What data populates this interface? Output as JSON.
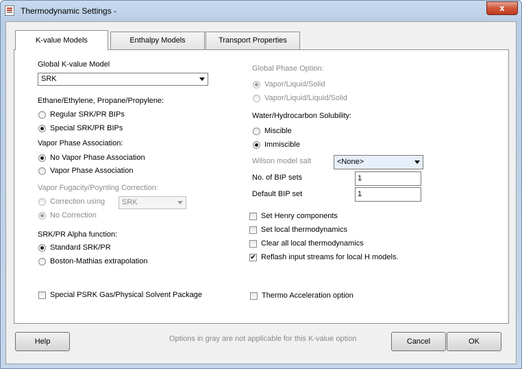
{
  "window": {
    "title": "Thermodynamic Settings -",
    "close": "x"
  },
  "tabs": [
    {
      "label": "K-value Models",
      "active": true
    },
    {
      "label": "Enthalpy Models",
      "active": false
    },
    {
      "label": "Transport Properties",
      "active": false
    }
  ],
  "left": {
    "global_k_label": "Global K-value Model",
    "global_k_value": "SRK",
    "ethane_label": "Ethane/Ethylene, Propane/Propylene:",
    "ethane_options": [
      "Regular SRK/PR BIPs",
      "Special SRK/PR BIPs"
    ],
    "vpa_label": "Vapor Phase Association:",
    "vpa_options": [
      "No Vapor Phase Association",
      "Vapor Phase Association"
    ],
    "fugacity_label": "Vapor Fugacity/Poynting Correction:",
    "fugacity_options": [
      "Correction using",
      "No Correction"
    ],
    "fugacity_select": "SRK",
    "alpha_label": "SRK/PR Alpha function:",
    "alpha_options": [
      "Standard SRK/PR",
      "Boston-Mathias extrapolation"
    ],
    "psrk_label": "Special PSRK Gas/Physical Solvent Package"
  },
  "right": {
    "global_phase_label": "Global Phase Option:",
    "phase_options": [
      "Vapor/Liquid/Solid",
      "Vapor/Liquid/Liquid/Solid"
    ],
    "water_label": "Water/Hydrocarbon Solubility:",
    "water_options": [
      "Miscible",
      "Immiscible"
    ],
    "wilson_label": "Wilson model salt",
    "wilson_value": "<None>",
    "bip_sets_label": "No. of BIP sets",
    "bip_sets_value": "1",
    "default_bip_label": "Default BIP set",
    "default_bip_value": "1",
    "checks": [
      {
        "label": "Set Henry components",
        "checked": false
      },
      {
        "label": "Set local thermodynamics",
        "checked": false
      },
      {
        "label": "Clear all local thermodynamics",
        "checked": false
      },
      {
        "label": "Reflash input streams for local H models.",
        "checked": true
      }
    ],
    "thermo_accel_label": "Thermo Acceleration option"
  },
  "footer": {
    "help": "Help",
    "note": "Options in gray are not applicable for this K-value option",
    "cancel": "Cancel",
    "ok": "OK"
  }
}
